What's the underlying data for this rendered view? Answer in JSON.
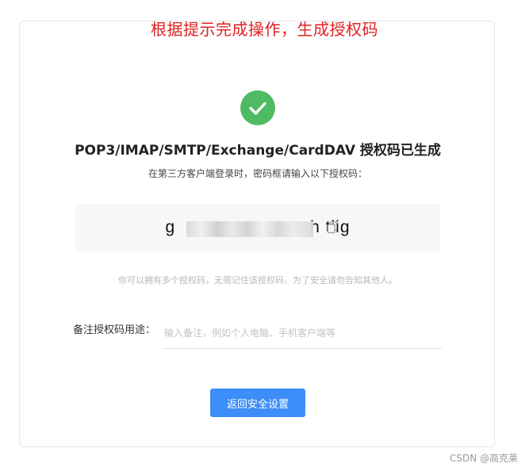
{
  "annotation": {
    "text": "根据提示完成操作，生成授权码",
    "color": "#e02020"
  },
  "status": {
    "icon": "checkmark-icon",
    "color": "#4ebb63"
  },
  "title": "POP3/IMAP/SMTP/Exchange/CardDAV 授权码已生成",
  "subtitle": "在第三方客户端登录时，密码框请输入以下授权码：",
  "auth_code": {
    "visible_start": "g",
    "visible_end": "h tiig",
    "masked": true,
    "copy_icon": "copy-icon"
  },
  "hint": "你可以拥有多个授权码，无需记住该授权码，为了安全请勿告知其他人。",
  "remark": {
    "label": "备注授权码用途：",
    "placeholder": "输入备注，例如个人电脑、手机客户端等",
    "value": ""
  },
  "actions": {
    "back_label": "返回安全设置",
    "accent_color": "#3d8ef8"
  },
  "watermark": "CSDN @高克莱"
}
